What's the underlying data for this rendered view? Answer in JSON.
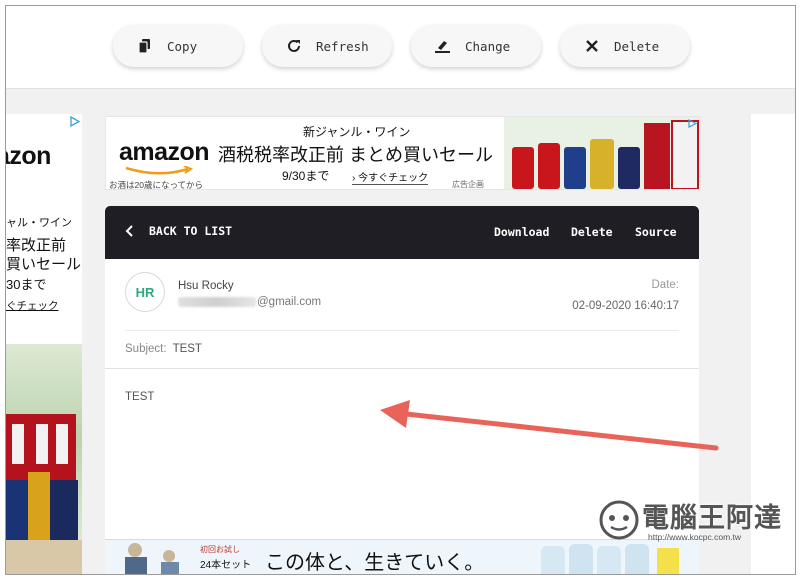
{
  "toolbar": {
    "copy_label": "Copy",
    "refresh_label": "Refresh",
    "change_label": "Change",
    "delete_label": "Delete"
  },
  "left_ad": {
    "brand": "azon",
    "line1": "ャル・ワイン",
    "line2": "率改正前",
    "line3": "買いセール",
    "line4": "30まで",
    "line5": "ぐチェック"
  },
  "banner_ad": {
    "brand": "amazon",
    "tagline": "新ジャンル・ワイン",
    "headline": "酒税税率改正前 まとめ買いセール",
    "date": "9/30まで",
    "cta": "› 今すぐチェック",
    "disclaimer": "お酒は20歳になってから",
    "ad_label": "広告企画"
  },
  "mail": {
    "back_label": "BACK TO LIST",
    "actions": [
      "Download",
      "Delete",
      "Source"
    ],
    "avatar_initials": "HR",
    "sender_name": "Hsu Rocky",
    "sender_email_suffix": "@gmail.com",
    "date_label": "Date:",
    "date_value": "02-09-2020 16:40:17",
    "subject_label": "Subject:",
    "subject_value": "TEST",
    "body": "TEST"
  },
  "bottom_ad": {
    "promo_small": "初回お試し",
    "promo_count": "24本セット",
    "headline": "この体と、生きていく。"
  },
  "watermark": {
    "text": "電腦王阿達",
    "url": "http://www.kocpc.com.tw"
  },
  "colors": {
    "header_bg": "#1f1e24",
    "avatar_text": "#2ea87a",
    "arrow": "#e8645a"
  }
}
